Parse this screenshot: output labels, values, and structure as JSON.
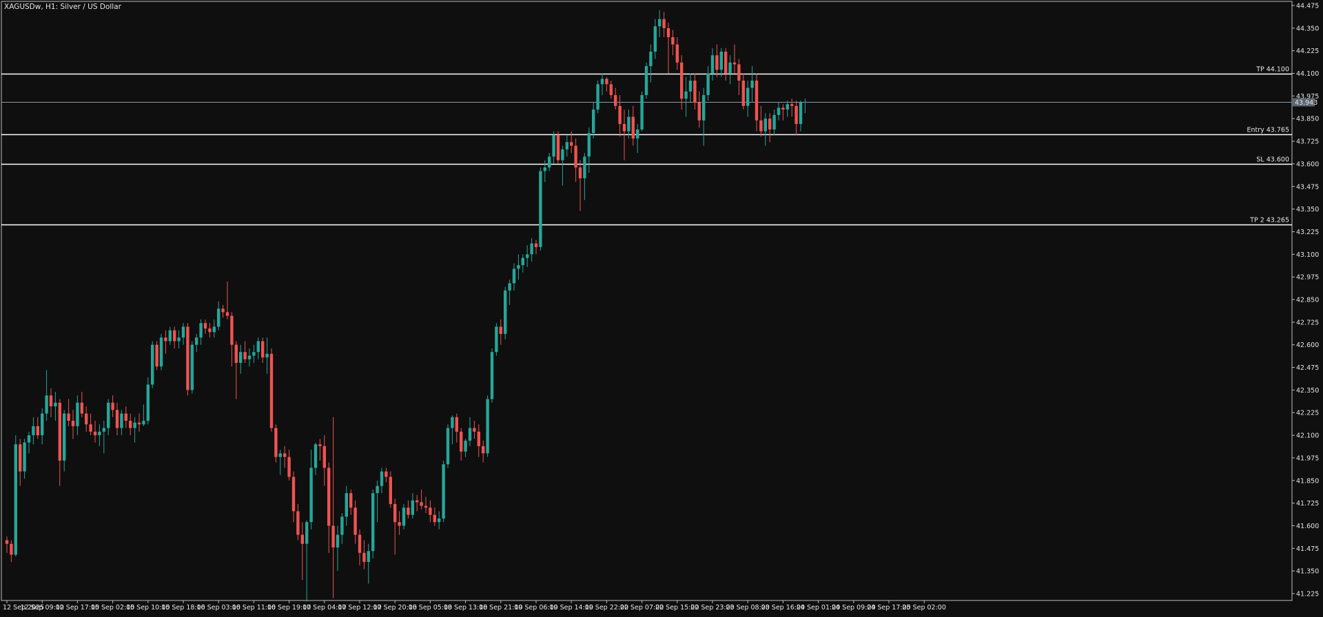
{
  "header": {
    "title": "XAGUSDw, H1:  Silver / US Dollar"
  },
  "colors": {
    "background": "#0f0f0f",
    "bull": "#26a69a",
    "bear": "#ef5350",
    "text": "#e6e6e6",
    "level_line": "#ffffff",
    "current_price_line": "#8c9eab",
    "frame": "#bfbfbf"
  },
  "chart_data": {
    "type": "candlestick",
    "symbol": "XAGUSDw",
    "timeframe": "H1",
    "description": "Silver / US Dollar",
    "y_range": [
      41.14,
      44.5
    ],
    "y_ticks": [
      "44.475",
      "44.350",
      "44.225",
      "44.100",
      "43.975",
      "43.850",
      "43.725",
      "43.600",
      "43.475",
      "43.350",
      "43.225",
      "43.100",
      "42.975",
      "42.850",
      "42.725",
      "42.600",
      "42.475",
      "42.350",
      "42.225",
      "42.100",
      "41.975",
      "41.850",
      "41.725",
      "41.600",
      "41.475",
      "41.350",
      "41.225"
    ],
    "x_ticks": [
      {
        "label": "12 Sep 2025",
        "index": 0
      },
      {
        "label": "12 Sep 09:00",
        "index": 8
      },
      {
        "label": "12 Sep 17:00",
        "index": 16
      },
      {
        "label": "15 Sep 02:00",
        "index": 24
      },
      {
        "label": "15 Sep 10:00",
        "index": 32
      },
      {
        "label": "15 Sep 18:00",
        "index": 40
      },
      {
        "label": "16 Sep 03:00",
        "index": 48
      },
      {
        "label": "16 Sep 11:00",
        "index": 56
      },
      {
        "label": "16 Sep 19:00",
        "index": 64
      },
      {
        "label": "17 Sep 04:00",
        "index": 72
      },
      {
        "label": "17 Sep 12:00",
        "index": 80
      },
      {
        "label": "17 Sep 20:00",
        "index": 88
      },
      {
        "label": "18 Sep 05:00",
        "index": 96
      },
      {
        "label": "18 Sep 13:00",
        "index": 104
      },
      {
        "label": "18 Sep 21:00",
        "index": 112
      },
      {
        "label": "19 Sep 06:00",
        "index": 120
      },
      {
        "label": "19 Sep 14:00",
        "index": 128
      },
      {
        "label": "19 Sep 22:00",
        "index": 136
      },
      {
        "label": "22 Sep 07:00",
        "index": 144
      },
      {
        "label": "22 Sep 15:00",
        "index": 152
      },
      {
        "label": "22 Sep 23:00",
        "index": 160
      },
      {
        "label": "23 Sep 08:00",
        "index": 168
      },
      {
        "label": "23 Sep 16:00",
        "index": 176
      },
      {
        "label": "24 Sep 01:00",
        "index": 184
      },
      {
        "label": "24 Sep 09:00",
        "index": 192
      },
      {
        "label": "24 Sep 17:00",
        "index": 200
      },
      {
        "label": "25 Sep 02:00",
        "index": 208
      }
    ],
    "levels": [
      {
        "label": "TP 44.100",
        "price": 44.1
      },
      {
        "label": "Entry 43.765",
        "price": 43.765
      },
      {
        "label": "SL 43.600",
        "price": 43.6
      },
      {
        "label": "TP 2 43.265",
        "price": 43.265
      }
    ],
    "current_price": {
      "label": "43.943",
      "value": 43.943
    },
    "candles": [
      [
        41.52,
        41.54,
        41.45,
        41.5
      ],
      [
        41.5,
        41.52,
        41.4,
        41.44
      ],
      [
        41.44,
        42.1,
        41.43,
        42.05
      ],
      [
        42.05,
        42.08,
        41.82,
        41.9
      ],
      [
        41.9,
        42.08,
        41.86,
        42.06
      ],
      [
        42.06,
        42.12,
        42.0,
        42.1
      ],
      [
        42.1,
        42.2,
        42.05,
        42.15
      ],
      [
        42.15,
        42.2,
        42.08,
        42.1
      ],
      [
        42.1,
        42.25,
        42.05,
        42.22
      ],
      [
        42.22,
        42.46,
        42.18,
        42.32
      ],
      [
        42.32,
        42.36,
        42.2,
        42.26
      ],
      [
        42.26,
        42.34,
        42.18,
        42.28
      ],
      [
        42.28,
        42.3,
        41.82,
        41.96
      ],
      [
        41.96,
        42.24,
        41.9,
        42.22
      ],
      [
        42.22,
        42.3,
        42.15,
        42.18
      ],
      [
        42.18,
        42.24,
        42.08,
        42.15
      ],
      [
        42.15,
        42.32,
        42.1,
        42.28
      ],
      [
        42.28,
        42.34,
        42.2,
        42.22
      ],
      [
        42.22,
        42.26,
        42.12,
        42.16
      ],
      [
        42.16,
        42.22,
        42.1,
        42.12
      ],
      [
        42.12,
        42.18,
        42.06,
        42.1
      ],
      [
        42.1,
        42.16,
        42.04,
        42.12
      ],
      [
        42.12,
        42.18,
        42.0,
        42.14
      ],
      [
        42.14,
        42.3,
        42.1,
        42.28
      ],
      [
        42.28,
        42.32,
        42.2,
        42.24
      ],
      [
        42.24,
        42.28,
        42.1,
        42.14
      ],
      [
        42.14,
        42.24,
        42.1,
        42.22
      ],
      [
        42.22,
        42.26,
        42.14,
        42.18
      ],
      [
        42.18,
        42.22,
        42.1,
        42.14
      ],
      [
        42.14,
        42.2,
        42.06,
        42.17
      ],
      [
        42.17,
        42.22,
        42.12,
        42.16
      ],
      [
        42.16,
        42.27,
        42.15,
        42.18
      ],
      [
        42.18,
        42.42,
        42.16,
        42.38
      ],
      [
        42.38,
        42.62,
        42.36,
        42.6
      ],
      [
        42.6,
        42.62,
        42.46,
        42.48
      ],
      [
        42.48,
        42.66,
        42.46,
        42.64
      ],
      [
        42.64,
        42.68,
        42.55,
        42.62
      ],
      [
        42.62,
        42.7,
        42.6,
        42.68
      ],
      [
        42.68,
        42.7,
        42.58,
        42.62
      ],
      [
        42.62,
        42.68,
        42.58,
        42.64
      ],
      [
        42.64,
        42.72,
        42.6,
        42.7
      ],
      [
        42.7,
        42.72,
        42.32,
        42.35
      ],
      [
        42.35,
        42.62,
        42.33,
        42.6
      ],
      [
        42.6,
        42.66,
        42.56,
        42.64
      ],
      [
        42.64,
        42.74,
        42.6,
        42.72
      ],
      [
        42.72,
        42.74,
        42.66,
        42.69
      ],
      [
        42.69,
        42.72,
        42.64,
        42.67
      ],
      [
        42.67,
        42.74,
        42.64,
        42.7
      ],
      [
        42.7,
        42.84,
        42.68,
        42.8
      ],
      [
        42.8,
        42.82,
        42.75,
        42.78
      ],
      [
        42.78,
        42.95,
        42.74,
        42.76
      ],
      [
        42.76,
        42.78,
        42.48,
        42.6
      ],
      [
        42.6,
        42.62,
        42.3,
        42.5
      ],
      [
        42.5,
        42.6,
        42.44,
        42.56
      ],
      [
        42.56,
        42.62,
        42.5,
        42.52
      ],
      [
        42.52,
        42.58,
        42.48,
        42.54
      ],
      [
        42.54,
        42.6,
        42.5,
        42.56
      ],
      [
        42.56,
        42.64,
        42.52,
        42.62
      ],
      [
        42.62,
        42.64,
        42.5,
        42.53
      ],
      [
        42.53,
        42.64,
        42.44,
        42.55
      ],
      [
        42.55,
        42.58,
        42.12,
        42.14
      ],
      [
        42.14,
        42.16,
        41.95,
        41.98
      ],
      [
        41.98,
        42.02,
        41.88,
        42.0
      ],
      [
        42.0,
        42.04,
        41.92,
        41.98
      ],
      [
        41.98,
        42.02,
        41.85,
        41.87
      ],
      [
        41.87,
        41.9,
        41.62,
        41.68
      ],
      [
        41.68,
        41.72,
        41.52,
        41.55
      ],
      [
        41.55,
        41.62,
        41.3,
        41.5
      ],
      [
        41.5,
        41.63,
        41.18,
        41.62
      ],
      [
        41.62,
        42.02,
        41.58,
        41.92
      ],
      [
        41.92,
        42.06,
        41.88,
        42.05
      ],
      [
        42.05,
        42.08,
        41.96,
        42.04
      ],
      [
        42.04,
        42.1,
        41.82,
        41.92
      ],
      [
        41.92,
        41.95,
        41.45,
        41.6
      ],
      [
        41.6,
        42.2,
        41.2,
        41.48
      ],
      [
        41.48,
        41.6,
        41.35,
        41.55
      ],
      [
        41.55,
        41.67,
        41.5,
        41.65
      ],
      [
        41.65,
        41.82,
        41.6,
        41.78
      ],
      [
        41.78,
        41.8,
        41.66,
        41.7
      ],
      [
        41.7,
        41.74,
        41.5,
        41.55
      ],
      [
        41.55,
        41.58,
        41.38,
        41.45
      ],
      [
        41.45,
        41.52,
        41.36,
        41.4
      ],
      [
        41.4,
        41.5,
        41.28,
        41.46
      ],
      [
        41.46,
        41.8,
        41.42,
        41.78
      ],
      [
        41.78,
        41.85,
        41.62,
        41.82
      ],
      [
        41.82,
        41.92,
        41.78,
        41.9
      ],
      [
        41.9,
        41.92,
        41.84,
        41.87
      ],
      [
        41.87,
        41.9,
        41.7,
        41.72
      ],
      [
        41.72,
        41.75,
        41.44,
        41.62
      ],
      [
        41.62,
        41.68,
        41.55,
        41.6
      ],
      [
        41.6,
        41.72,
        41.58,
        41.7
      ],
      [
        41.7,
        41.74,
        41.64,
        41.66
      ],
      [
        41.66,
        41.78,
        41.64,
        41.74
      ],
      [
        41.74,
        41.77,
        41.68,
        41.73
      ],
      [
        41.73,
        41.8,
        41.69,
        41.71
      ],
      [
        41.71,
        41.76,
        41.67,
        41.7
      ],
      [
        41.7,
        41.74,
        41.62,
        41.66
      ],
      [
        41.66,
        41.7,
        41.6,
        41.62
      ],
      [
        41.62,
        41.68,
        41.58,
        41.64
      ],
      [
        41.64,
        41.96,
        41.62,
        41.94
      ],
      [
        41.94,
        42.16,
        41.92,
        42.14
      ],
      [
        42.14,
        42.21,
        42.05,
        42.2
      ],
      [
        42.2,
        42.22,
        42.06,
        42.12
      ],
      [
        42.12,
        42.14,
        41.96,
        42.01
      ],
      [
        42.01,
        42.08,
        41.98,
        42.07
      ],
      [
        42.07,
        42.2,
        42.04,
        42.14
      ],
      [
        42.14,
        42.18,
        42.08,
        42.12
      ],
      [
        42.12,
        42.16,
        41.98,
        42.04
      ],
      [
        42.04,
        42.07,
        41.95,
        42.0
      ],
      [
        42.0,
        42.32,
        41.98,
        42.3
      ],
      [
        42.3,
        42.58,
        42.28,
        42.56
      ],
      [
        42.56,
        42.72,
        42.54,
        42.7
      ],
      [
        42.7,
        42.74,
        42.6,
        42.66
      ],
      [
        42.66,
        42.92,
        42.63,
        42.9
      ],
      [
        42.9,
        42.96,
        42.82,
        42.94
      ],
      [
        42.94,
        43.05,
        42.9,
        43.02
      ],
      [
        43.02,
        43.1,
        42.96,
        43.04
      ],
      [
        43.04,
        43.1,
        43.0,
        43.08
      ],
      [
        43.08,
        43.15,
        43.03,
        43.1
      ],
      [
        43.1,
        43.19,
        43.06,
        43.16
      ],
      [
        43.16,
        43.18,
        43.1,
        43.14
      ],
      [
        43.14,
        43.58,
        43.12,
        43.56
      ],
      [
        43.56,
        43.62,
        43.5,
        43.58
      ],
      [
        43.58,
        43.66,
        43.56,
        43.64
      ],
      [
        43.64,
        43.78,
        43.6,
        43.76
      ],
      [
        43.76,
        43.78,
        43.6,
        43.62
      ],
      [
        43.62,
        43.7,
        43.48,
        43.68
      ],
      [
        43.68,
        43.76,
        43.64,
        43.72
      ],
      [
        43.72,
        43.78,
        43.66,
        43.7
      ],
      [
        43.7,
        43.74,
        43.5,
        43.58
      ],
      [
        43.58,
        43.62,
        43.34,
        43.52
      ],
      [
        43.52,
        43.66,
        43.4,
        43.64
      ],
      [
        43.64,
        43.8,
        43.55,
        43.77
      ],
      [
        43.77,
        43.94,
        43.74,
        43.9
      ],
      [
        43.9,
        44.06,
        43.88,
        44.04
      ],
      [
        44.04,
        44.1,
        43.98,
        44.07
      ],
      [
        44.07,
        44.08,
        44.0,
        44.04
      ],
      [
        44.04,
        44.06,
        43.96,
        43.98
      ],
      [
        43.98,
        44.02,
        43.9,
        43.92
      ],
      [
        43.92,
        43.98,
        43.75,
        43.82
      ],
      [
        43.82,
        43.9,
        43.62,
        43.78
      ],
      [
        43.78,
        43.9,
        43.74,
        43.86
      ],
      [
        43.86,
        43.92,
        43.7,
        43.74
      ],
      [
        43.74,
        43.82,
        43.66,
        43.79
      ],
      [
        43.79,
        44.0,
        43.78,
        43.98
      ],
      [
        43.98,
        44.16,
        43.96,
        44.14
      ],
      [
        44.14,
        44.26,
        44.05,
        44.22
      ],
      [
        44.22,
        44.4,
        44.18,
        44.36
      ],
      [
        44.36,
        44.45,
        44.3,
        44.4
      ],
      [
        44.4,
        44.44,
        44.3,
        44.35
      ],
      [
        44.35,
        44.38,
        44.1,
        44.3
      ],
      [
        44.3,
        44.34,
        44.2,
        44.26
      ],
      [
        44.26,
        44.3,
        44.12,
        44.16
      ],
      [
        44.16,
        44.2,
        43.9,
        43.96
      ],
      [
        43.96,
        44.08,
        43.86,
        44.0
      ],
      [
        44.0,
        44.1,
        43.94,
        44.06
      ],
      [
        44.06,
        44.1,
        43.9,
        43.94
      ],
      [
        43.94,
        44.0,
        43.8,
        43.84
      ],
      [
        43.84,
        44.02,
        43.7,
        43.98
      ],
      [
        43.98,
        44.14,
        43.95,
        44.1
      ],
      [
        44.1,
        44.24,
        44.06,
        44.2
      ],
      [
        44.2,
        44.26,
        44.08,
        44.12
      ],
      [
        44.12,
        44.24,
        44.08,
        44.22
      ],
      [
        44.22,
        44.24,
        44.06,
        44.1
      ],
      [
        44.1,
        44.2,
        44.04,
        44.16
      ],
      [
        44.16,
        44.26,
        44.1,
        44.15
      ],
      [
        44.15,
        44.18,
        43.98,
        44.06
      ],
      [
        44.06,
        44.1,
        43.9,
        43.92
      ],
      [
        43.92,
        44.06,
        43.86,
        44.02
      ],
      [
        44.02,
        44.14,
        43.94,
        44.06
      ],
      [
        44.06,
        44.1,
        43.78,
        43.84
      ],
      [
        43.84,
        43.92,
        43.75,
        43.78
      ],
      [
        43.78,
        43.88,
        43.7,
        43.85
      ],
      [
        43.85,
        43.88,
        43.72,
        43.79
      ],
      [
        43.79,
        43.9,
        43.76,
        43.87
      ],
      [
        43.87,
        43.94,
        43.84,
        43.91
      ],
      [
        43.91,
        43.93,
        43.84,
        43.9
      ],
      [
        43.9,
        43.95,
        43.86,
        43.93
      ],
      [
        43.93,
        43.96,
        43.86,
        43.92
      ],
      [
        43.92,
        43.95,
        43.76,
        43.82
      ],
      [
        43.82,
        43.95,
        43.78,
        43.94
      ],
      [
        43.94,
        43.96,
        43.88,
        43.943
      ]
    ]
  }
}
